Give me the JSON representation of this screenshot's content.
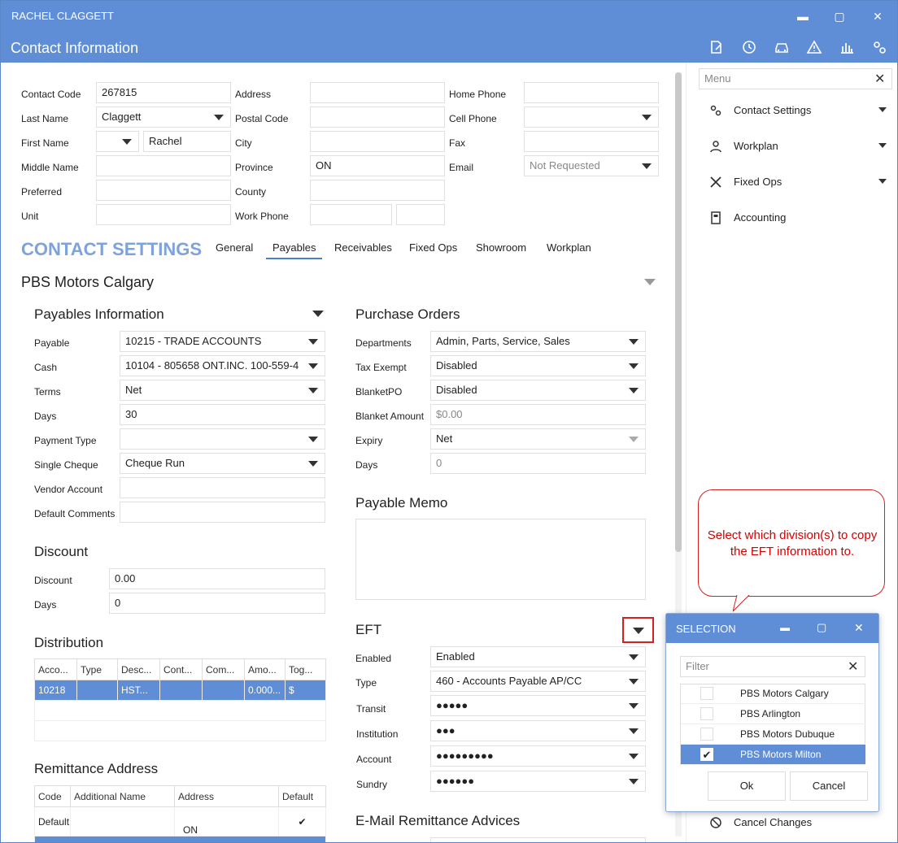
{
  "window": {
    "title": "RACHEL CLAGGETT",
    "minimize": "▬",
    "maximize": "▢",
    "close": "✕"
  },
  "header": {
    "title": "Contact Information",
    "icons": [
      "edit-icon",
      "history-icon",
      "vehicle-icon",
      "warning-icon",
      "chart-icon",
      "settings-icon"
    ]
  },
  "contact": {
    "labels": {
      "code": "Contact Code",
      "last": "Last Name",
      "first": "First Name",
      "middle": "Middle Name",
      "preferred": "Preferred",
      "unit": "Unit",
      "address": "Address",
      "postal": "Postal Code",
      "city": "City",
      "province": "Province",
      "county": "County",
      "work": "Work Phone",
      "home": "Home Phone",
      "cell": "Cell Phone",
      "fax": "Fax",
      "email": "Email"
    },
    "code": "267815",
    "last": "Claggett",
    "first": "Rachel",
    "province": "ON",
    "email_placeholder": "Not Requested"
  },
  "settings": {
    "title": "CONTACT SETTINGS",
    "tabs": [
      "General",
      "Payables",
      "Receivables",
      "Fixed Ops",
      "Showroom",
      "Workplan"
    ],
    "division": "PBS Motors Calgary"
  },
  "payables": {
    "title": "Payables Information",
    "labels": {
      "payable": "Payable",
      "cash": "Cash",
      "terms": "Terms",
      "days": "Days",
      "ptype": "Payment Type",
      "single": "Single Cheque",
      "vendor": "Vendor Account",
      "comments": "Default Comments"
    },
    "payable": "10215 - TRADE ACCOUNTS",
    "cash": "10104 - 805658 ONT.INC. 100-559-4",
    "terms": "Net",
    "days": "30",
    "single": "Cheque Run"
  },
  "discount": {
    "title": "Discount",
    "labels": {
      "discount": "Discount",
      "days": "Days"
    },
    "discount": "0.00",
    "days": "0"
  },
  "distribution": {
    "title": "Distribution",
    "columns": [
      "Acco...",
      "Type",
      "Desc...",
      "Cont...",
      "Com...",
      "Amo...",
      "Tog..."
    ],
    "rows": [
      [
        "10218",
        "",
        "HST...",
        "",
        "",
        "0.000...",
        "$"
      ]
    ]
  },
  "remittance": {
    "title": "Remittance Address",
    "columns": [
      "Code",
      "Additional Name",
      "Address",
      "Default"
    ],
    "rows": [
      [
        "Default",
        "",
        "ON",
        "✔"
      ]
    ]
  },
  "purchase": {
    "title": "Purchase Orders",
    "labels": {
      "dept": "Departments",
      "tax": "Tax Exempt",
      "blanket": "BlanketPO",
      "amount": "Blanket Amount",
      "expiry": "Expiry",
      "days": "Days"
    },
    "dept": "Admin, Parts, Service, Sales",
    "tax": "Disabled",
    "blanket": "Disabled",
    "amount": "$0.00",
    "expiry": "Net",
    "days": "0"
  },
  "memo": {
    "title": "Payable Memo"
  },
  "eft": {
    "title": "EFT",
    "labels": {
      "enabled": "Enabled",
      "type": "Type",
      "transit": "Transit",
      "institution": "Institution",
      "account": "Account",
      "sundry": "Sundry"
    },
    "enabled": "Enabled",
    "type": "460 - Accounts Payable AP/CC",
    "transit": "●●●●●",
    "institution": "●●●",
    "account": "●●●●●●●●●",
    "sundry": "●●●●●●"
  },
  "email_remit": {
    "title": "E-Mail Remittance Advices"
  },
  "menu": {
    "placeholder": "Menu",
    "close": "✕",
    "items": [
      {
        "label": "Contact Settings",
        "icon": "gears-icon"
      },
      {
        "label": "Workplan",
        "icon": "person-icon"
      },
      {
        "label": "Fixed Ops",
        "icon": "tools-icon"
      },
      {
        "label": "Accounting",
        "icon": "calculator-icon"
      }
    ],
    "cancel": "Cancel Changes"
  },
  "callout": {
    "text": "Select which division(s) to copy the EFT information to."
  },
  "selection": {
    "title": "SELECTION",
    "filter_placeholder": "Filter",
    "close": "✕",
    "items": [
      {
        "label": "PBS Motors Calgary",
        "checked": false
      },
      {
        "label": "PBS Arlington",
        "checked": false
      },
      {
        "label": "PBS Motors Dubuque",
        "checked": false
      },
      {
        "label": "PBS Motors Milton",
        "checked": true
      }
    ],
    "ok": "Ok",
    "cancel": "Cancel"
  },
  "colors": {
    "accent": "#5f8ed6",
    "section_title": "#7ea2dc",
    "callout": "#d40000"
  }
}
